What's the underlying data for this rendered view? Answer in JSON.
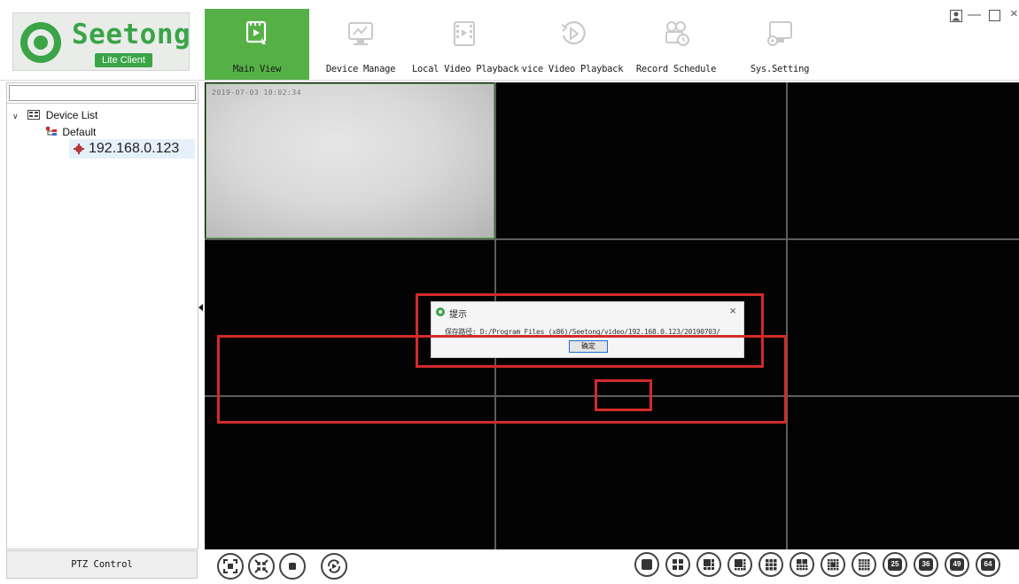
{
  "app": {
    "logo_title": "Seetong",
    "logo_subtitle": "Lite Client",
    "brand_color": "#3aa447"
  },
  "nav": {
    "tabs": [
      {
        "label": "Main View",
        "icon": "main-view-icon",
        "active": true
      },
      {
        "label": "Device Manage",
        "icon": "device-manage-icon",
        "active": false
      },
      {
        "label": "Local Video Playback",
        "icon": "local-playback-icon",
        "active": false
      },
      {
        "label": "Device Video Playback",
        "icon": "device-playback-icon",
        "active": false
      },
      {
        "label": "Record Schedule",
        "icon": "record-schedule-icon",
        "active": false
      },
      {
        "label": "Sys.Setting",
        "icon": "sys-setting-icon",
        "active": false
      }
    ],
    "active_color": "#55b146"
  },
  "window_controls": {
    "user": "user-icon",
    "minimize": "minimize-icon",
    "maximize": "maximize-icon",
    "close": "close-icon"
  },
  "left_panel": {
    "search_value": "",
    "tree": {
      "root_label": "Device List",
      "group_label": "Default",
      "device_label": "192.168.0.123"
    },
    "ptz_label": "PTZ Control"
  },
  "video": {
    "osd": "2019-07-03 10:02:34",
    "grid": "3x3"
  },
  "dialog": {
    "title": "提示",
    "message": "保存路径: D:/Program Files (x86)/Seetong/video/192.168.0.123/20190703/",
    "ok_label": "确定",
    "close": "close-icon"
  },
  "annotations": {
    "highlight_color": "#d32a2a"
  },
  "bottom_bar": {
    "controls": [
      "fullscreen-icon",
      "exit-fullscreen-icon",
      "stop-icon",
      "cycle-icon"
    ],
    "layouts": [
      "1",
      "4",
      "6",
      "8",
      "9",
      "10",
      "13",
      "16",
      "25",
      "36",
      "49",
      "64"
    ],
    "layout_labels": [
      "25",
      "36",
      "49",
      "64"
    ]
  }
}
